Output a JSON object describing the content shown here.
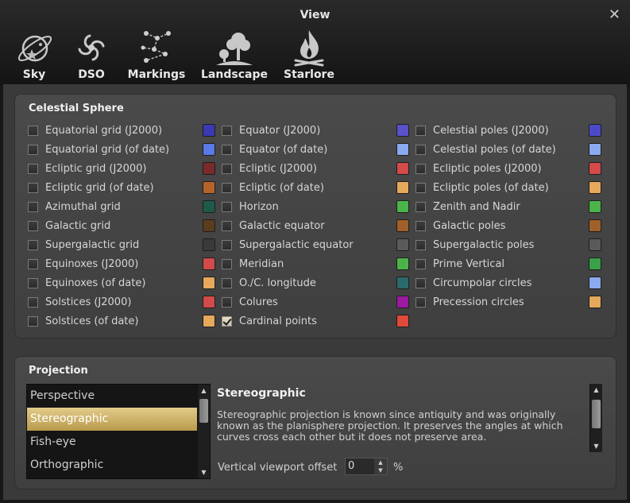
{
  "window": {
    "title": "View",
    "close": "✕"
  },
  "tabs": [
    {
      "label": "Sky",
      "icon": "planet-icon"
    },
    {
      "label": "DSO",
      "icon": "galaxy-icon"
    },
    {
      "label": "Markings",
      "icon": "constellation-icon"
    },
    {
      "label": "Landscape",
      "icon": "tree-icon"
    },
    {
      "label": "Starlore",
      "icon": "campfire-icon"
    }
  ],
  "celestial": {
    "title": "Celestial Sphere",
    "columns": [
      [
        {
          "label": "Equatorial grid (J2000)",
          "checked": false,
          "color": "#3a3ab4"
        },
        {
          "label": "Equatorial grid (of date)",
          "checked": false,
          "color": "#5a78e6"
        },
        {
          "label": "Ecliptic grid (J2000)",
          "checked": false,
          "color": "#7a2a2a"
        },
        {
          "label": "Ecliptic grid (of date)",
          "checked": false,
          "color": "#b4642a"
        },
        {
          "label": "Azimuthal grid",
          "checked": false,
          "color": "#1e5a4a"
        },
        {
          "label": "Galactic grid",
          "checked": false,
          "color": "#5a3c1e"
        },
        {
          "label": "Supergalactic grid",
          "checked": false,
          "color": "#3a3a3a"
        },
        {
          "label": "Equinoxes (J2000)",
          "checked": false,
          "color": "#d24a4a"
        },
        {
          "label": "Equinoxes (of date)",
          "checked": false,
          "color": "#e6a85a"
        },
        {
          "label": "Solstices (J2000)",
          "checked": false,
          "color": "#d24a4a"
        },
        {
          "label": "Solstices (of date)",
          "checked": false,
          "color": "#e6a85a"
        }
      ],
      [
        {
          "label": "Equator (J2000)",
          "checked": false,
          "color": "#5a50c8"
        },
        {
          "label": "Equator (of date)",
          "checked": false,
          "color": "#8aaaf0"
        },
        {
          "label": "Ecliptic (J2000)",
          "checked": false,
          "color": "#d24a4a"
        },
        {
          "label": "Ecliptic (of date)",
          "checked": false,
          "color": "#e6a85a"
        },
        {
          "label": "Horizon",
          "checked": false,
          "color": "#4ab44a"
        },
        {
          "label": "Galactic equator",
          "checked": false,
          "color": "#a0602a"
        },
        {
          "label": "Supergalactic equator",
          "checked": false,
          "color": "#5a5a5a"
        },
        {
          "label": "Meridian",
          "checked": false,
          "color": "#4ab44a"
        },
        {
          "label": "O./C. longitude",
          "checked": false,
          "color": "#2a6a6a"
        },
        {
          "label": "Colures",
          "checked": false,
          "color": "#9a1aa0"
        },
        {
          "label": "Cardinal points",
          "checked": true,
          "color": "#e04a3a"
        }
      ],
      [
        {
          "label": "Celestial poles (J2000)",
          "checked": false,
          "color": "#4a4ac8"
        },
        {
          "label": "Celestial poles (of date)",
          "checked": false,
          "color": "#8aaaf0"
        },
        {
          "label": "Ecliptic poles (J2000)",
          "checked": false,
          "color": "#d24a4a"
        },
        {
          "label": "Ecliptic poles (of date)",
          "checked": false,
          "color": "#e6a85a"
        },
        {
          "label": "Zenith and Nadir",
          "checked": false,
          "color": "#4ab44a"
        },
        {
          "label": "Galactic poles",
          "checked": false,
          "color": "#a0602a"
        },
        {
          "label": "Supergalactic poles",
          "checked": false,
          "color": "#5a5a5a"
        },
        {
          "label": "Prime Vertical",
          "checked": false,
          "color": "#3aa04a"
        },
        {
          "label": "Circumpolar circles",
          "checked": false,
          "color": "#8aaaf0"
        },
        {
          "label": "Precession circles",
          "checked": false,
          "color": "#e6a85a"
        }
      ]
    ]
  },
  "projection": {
    "title": "Projection",
    "items": [
      "Perspective",
      "Stereographic",
      "Fish-eye",
      "Orthographic"
    ],
    "selected_index": 1,
    "selected_name": "Stereographic",
    "description": "Stereographic projection is known since antiquity and was originally known as the planisphere projection. It preserves the angles at which curves cross each other but it does not preserve area.",
    "offset_label": "Vertical viewport offset",
    "offset_value": "0",
    "offset_unit": "%"
  }
}
